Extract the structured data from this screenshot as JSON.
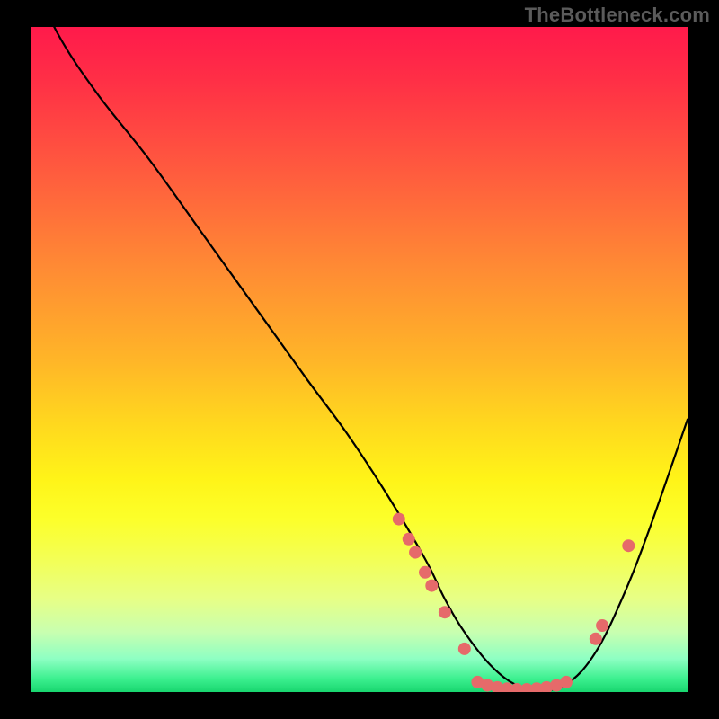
{
  "watermark": "TheBottleneck.com",
  "chart_data": {
    "type": "line",
    "title": "",
    "xlabel": "",
    "ylabel": "",
    "xlim": [
      0,
      100
    ],
    "ylim": [
      0,
      100
    ],
    "series": [
      {
        "name": "curve",
        "x": [
          0,
          4,
          10,
          18,
          26,
          34,
          42,
          48,
          54,
          60,
          63,
          66,
          70,
          74,
          78,
          82,
          86,
          90,
          94,
          100
        ],
        "y": [
          108,
          99,
          90,
          80,
          69,
          58,
          47,
          39,
          30,
          20,
          14,
          9,
          4,
          1,
          0.2,
          1.5,
          6,
          14,
          24,
          41
        ]
      }
    ],
    "markers": [
      {
        "x": 56.0,
        "y": 26.0
      },
      {
        "x": 57.5,
        "y": 23.0
      },
      {
        "x": 58.5,
        "y": 21.0
      },
      {
        "x": 60.0,
        "y": 18.0
      },
      {
        "x": 61.0,
        "y": 16.0
      },
      {
        "x": 63.0,
        "y": 12.0
      },
      {
        "x": 66.0,
        "y": 6.5
      },
      {
        "x": 68.0,
        "y": 1.5
      },
      {
        "x": 69.5,
        "y": 1.0
      },
      {
        "x": 71.0,
        "y": 0.7
      },
      {
        "x": 72.5,
        "y": 0.5
      },
      {
        "x": 74.0,
        "y": 0.4
      },
      {
        "x": 75.5,
        "y": 0.4
      },
      {
        "x": 77.0,
        "y": 0.5
      },
      {
        "x": 78.5,
        "y": 0.7
      },
      {
        "x": 80.0,
        "y": 1.0
      },
      {
        "x": 81.5,
        "y": 1.5
      },
      {
        "x": 86.0,
        "y": 8.0
      },
      {
        "x": 87.0,
        "y": 10.0
      },
      {
        "x": 91.0,
        "y": 22.0
      }
    ],
    "gradient_stops": [
      {
        "pos": 0,
        "color": "#ff1a4b"
      },
      {
        "pos": 36,
        "color": "#ff8a34"
      },
      {
        "pos": 60,
        "color": "#ffd91e"
      },
      {
        "pos": 80,
        "color": "#f3ff55"
      },
      {
        "pos": 95,
        "color": "#8effc3"
      },
      {
        "pos": 100,
        "color": "#18d66f"
      }
    ]
  }
}
